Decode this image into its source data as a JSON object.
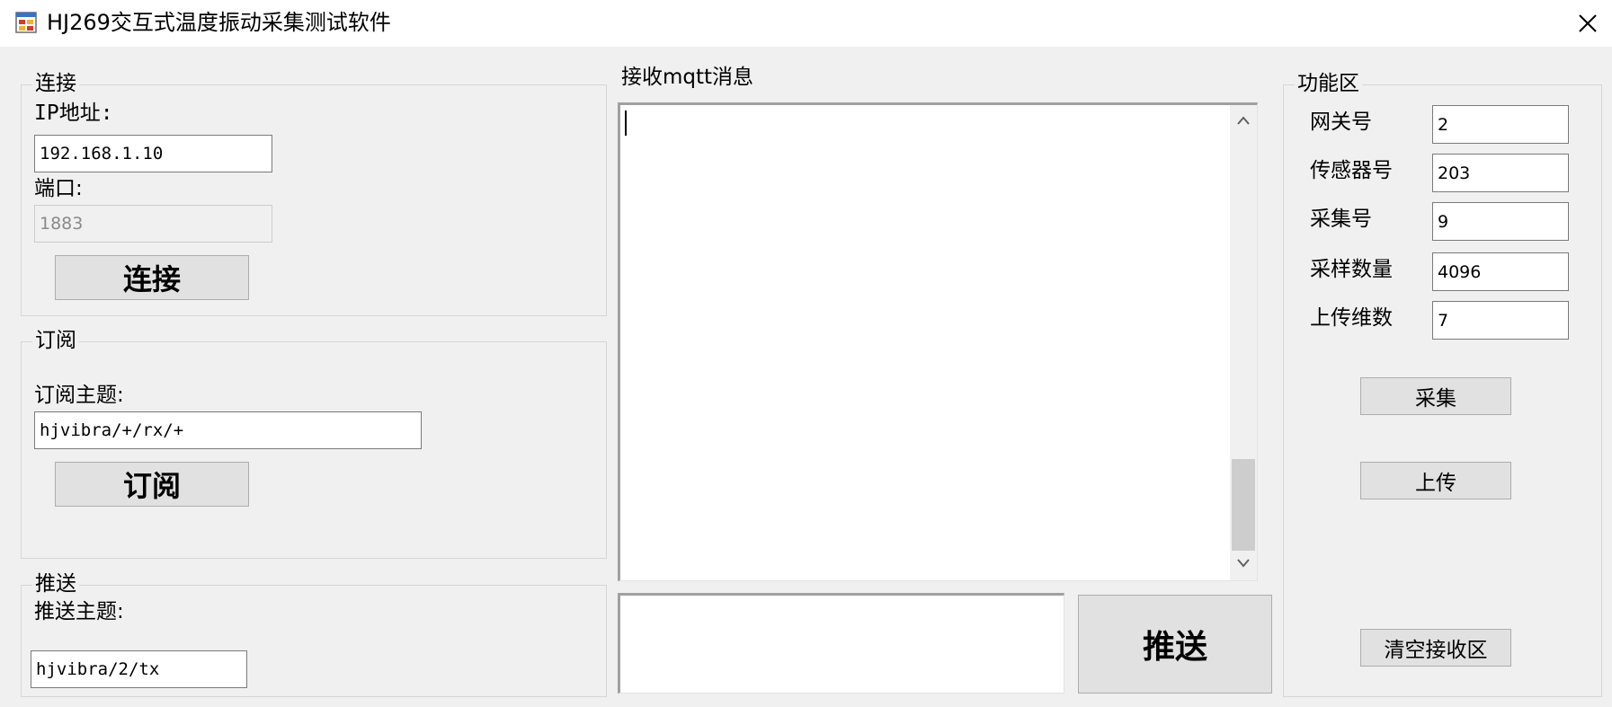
{
  "window": {
    "title": "HJ269交互式温度振动采集测试软件"
  },
  "connect_group": {
    "legend": "连接",
    "ip_label": "IP地址:",
    "ip_value": "192.168.1.10",
    "port_label": "端口:",
    "port_value": "1883",
    "connect_button": "连接"
  },
  "subscribe_group": {
    "legend": "订阅",
    "topic_label": "订阅主题:",
    "topic_value": "hjvibra/+/rx/+",
    "subscribe_button": "订阅"
  },
  "publish_group": {
    "legend": "推送",
    "topic_label": "推送主题:",
    "topic_value": "hjvibra/2/tx"
  },
  "center": {
    "receive_label": "接收mqtt消息",
    "receive_text": "",
    "send_text": "",
    "send_button": "推送"
  },
  "function_group": {
    "legend": "功能区",
    "gateway_label": "网关号",
    "gateway_value": "2",
    "sensor_label": "传感器号",
    "sensor_value": "203",
    "collect_no_label": "采集号",
    "collect_no_value": "9",
    "sample_count_label": "采样数量",
    "sample_count_value": "4096",
    "upload_dim_label": "上传维数",
    "upload_dim_value": "7",
    "collect_button": "采集",
    "upload_button": "上传",
    "clear_button": "清空接收区"
  },
  "colors": {
    "background": "#f0f0f0",
    "button_face": "#e1e1e1",
    "title_bar": "#ffffff"
  },
  "icons": {
    "app": "app-window-icon",
    "close": "close-icon",
    "scroll_up": "chevron-up-icon",
    "scroll_down": "chevron-down-icon"
  }
}
